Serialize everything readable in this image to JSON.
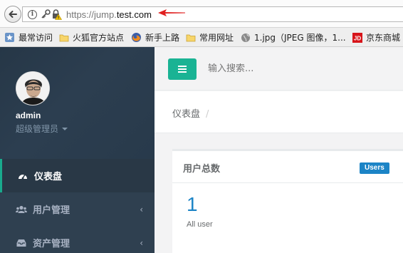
{
  "browser": {
    "url_prefix": "https://jump.",
    "url_domain": "test.com",
    "bookmarks": [
      {
        "label": "最常访问",
        "icon": "bookmark-star-icon"
      },
      {
        "label": "火狐官方站点",
        "icon": "folder-icon"
      },
      {
        "label": "新手上路",
        "icon": "firefox-icon"
      },
      {
        "label": "常用网址",
        "icon": "folder-icon"
      },
      {
        "label": "1.jpg（JPEG 图像，1...",
        "icon": "globe-icon"
      },
      {
        "label": "京东商城",
        "icon": "jd-icon"
      }
    ]
  },
  "sidebar": {
    "username": "admin",
    "role": "超级管理员",
    "items": [
      {
        "label": "仪表盘",
        "icon": "dashboard-icon",
        "active": true
      },
      {
        "label": "用户管理",
        "icon": "users-icon",
        "active": false
      },
      {
        "label": "资产管理",
        "icon": "inbox-icon",
        "active": false
      }
    ]
  },
  "topnav": {
    "search_placeholder": "输入搜索..."
  },
  "breadcrumb": {
    "current": "仪表盘",
    "separator": "/"
  },
  "widget": {
    "title": "用户总数",
    "badge": "Users",
    "value": "1",
    "label": "All user"
  },
  "colors": {
    "sidebar_bg": "#2f4050",
    "accent_green": "#1ab394",
    "badge_blue": "#1c84c6"
  }
}
